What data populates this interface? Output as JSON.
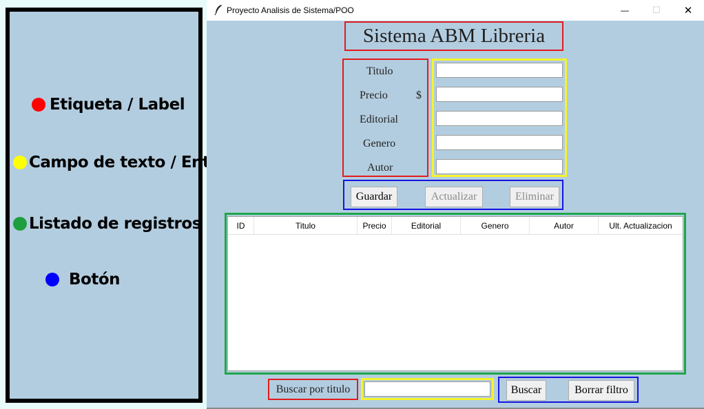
{
  "legend": {
    "items": [
      {
        "label": "Etiqueta / Label",
        "color": "#ff0000"
      },
      {
        "label": "Campo de texto / Entry",
        "color": "#ffff00"
      },
      {
        "label": "Listado de registros",
        "color": "#1e9e3e"
      },
      {
        "label": "Botón",
        "color": "#0000ff"
      }
    ]
  },
  "window": {
    "title": "Proyecto Analisis de Sistema/POO",
    "controls": {
      "minimize": "—",
      "maximize": "☐",
      "close": "✕"
    }
  },
  "app": {
    "title": "Sistema ABM Libreria",
    "form": {
      "titulo_label": "Titulo",
      "precio_label": "Precio",
      "currency": "$",
      "editorial_label": "Editorial",
      "genero_label": "Genero",
      "autor_label": "Autor",
      "titulo_value": "",
      "precio_value": "",
      "editorial_value": "",
      "genero_value": "",
      "autor_value": ""
    },
    "buttons": {
      "guardar": "Guardar",
      "actualizar": "Actualizar",
      "eliminar": "Eliminar"
    },
    "table": {
      "columns": [
        "ID",
        "Titulo",
        "Precio",
        "Editorial",
        "Genero",
        "Autor",
        "Ult. Actualizacion"
      ],
      "rows": []
    },
    "search": {
      "label": "Buscar por titulo",
      "value": "",
      "buscar": "Buscar",
      "borrar": "Borrar filtro"
    }
  },
  "colors": {
    "label_border": "#e21b1b",
    "entry_border": "#f4f42a",
    "list_border": "#1ea64a",
    "button_border": "#1414e0",
    "background": "#b3cde0"
  }
}
